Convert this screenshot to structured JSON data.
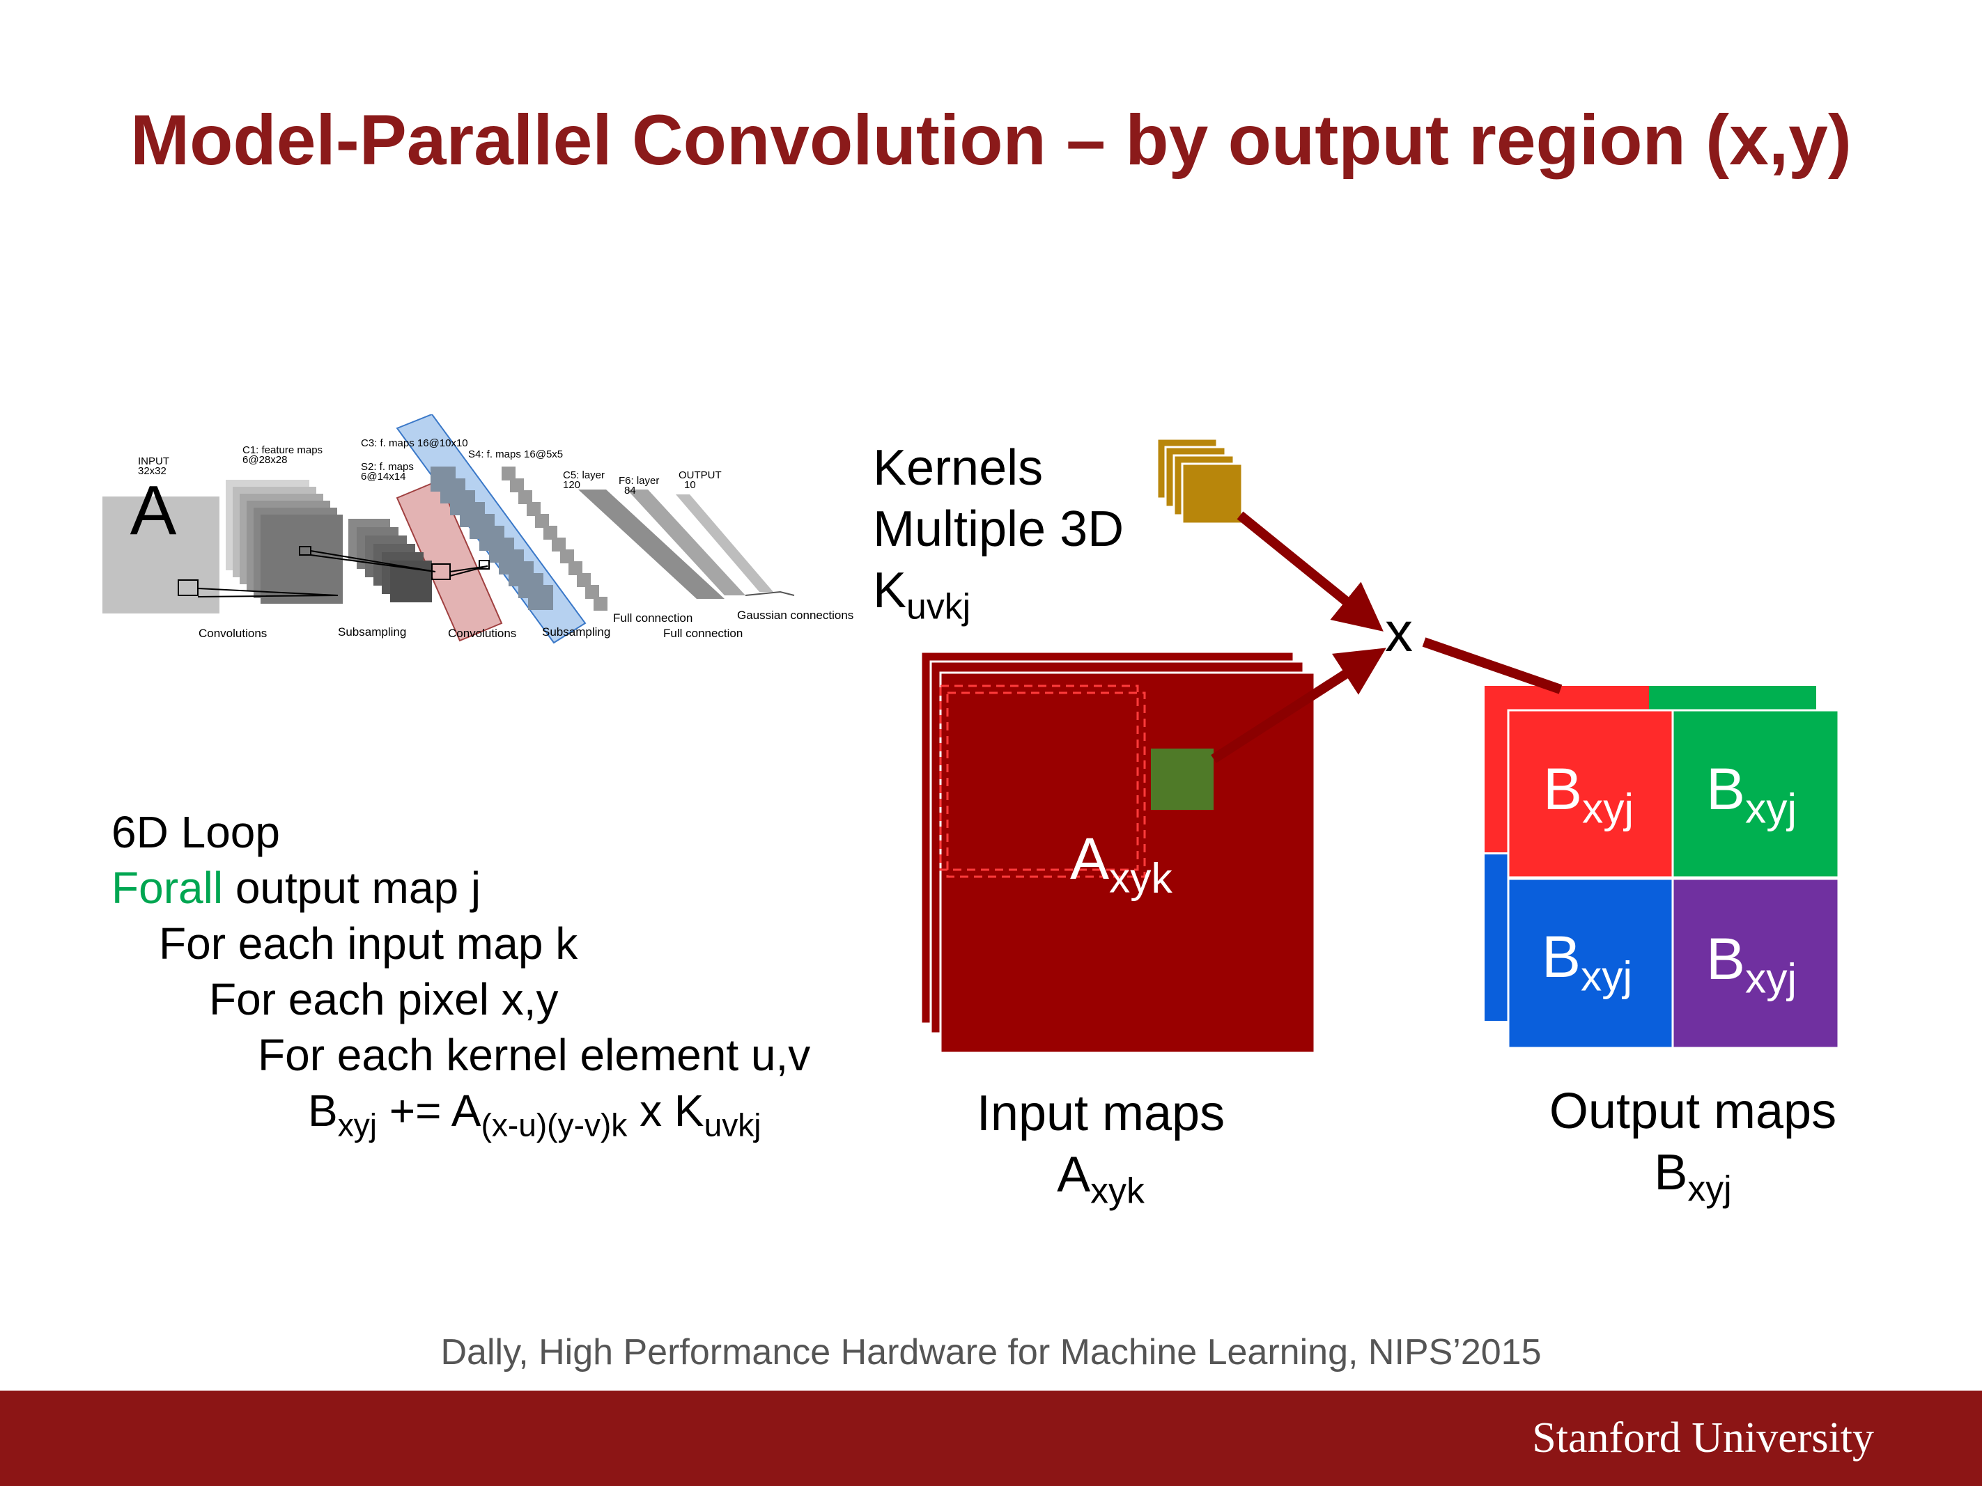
{
  "slide": {
    "title": "Model-Parallel Convolution – by output region (x,y)",
    "citation": "Dally, High Performance Hardware for Machine Learning, NIPS’2015",
    "footer_logo": "Stanford University"
  },
  "colors": {
    "title": "#8b1a1a",
    "footer_bar": "#8c1515",
    "input_map": "#990000",
    "kernel": "#b8860b",
    "arrow": "#8b0000",
    "kernel_window": "#4f7a28",
    "forall_keyword": "#00a651",
    "output_red": "#ff2a2a",
    "output_green": "#00b050",
    "output_blue": "#0a5fdc",
    "output_purple": "#7030a0"
  },
  "kernels_label": {
    "line1": "Kernels",
    "line2": "Multiple 3D",
    "symbol": "K",
    "symbol_sub": "uvkj"
  },
  "multiply_symbol": "x",
  "input_map_label": {
    "symbol": "A",
    "sub": "xyk"
  },
  "output_map_labels": [
    {
      "symbol": "B",
      "sub": "xyj"
    },
    {
      "symbol": "B",
      "sub": "xyj"
    },
    {
      "symbol": "B",
      "sub": "xyj"
    },
    {
      "symbol": "B",
      "sub": "xyj"
    }
  ],
  "input_caption": {
    "line1": "Input maps",
    "symbol": "A",
    "sub": "xyk"
  },
  "output_caption": {
    "line1": "Output maps",
    "symbol": "B",
    "sub": "xyj"
  },
  "loop": {
    "line1": "6D Loop",
    "forall_keyword": "Forall",
    "forall_rest": " output map j",
    "line3": "For each input map k",
    "line4": "For each pixel x,y",
    "line5": "For each kernel element u,v",
    "eq_b": "B",
    "eq_b_sub": "xyj",
    "eq_op": " += A",
    "eq_a_sub": "(x-u)(y-v)k",
    "eq_x": " x K",
    "eq_k_sub": "uvkj"
  },
  "lenet": {
    "input_label": "INPUT",
    "input_size": "32x32",
    "c1_label": "C1: feature maps",
    "c1_size": "6@28x28",
    "s2_label": "S2: f. maps",
    "s2_size": "6@14x14",
    "c3_label": "C3: f. maps 16@10x10",
    "s4_label": "S4: f. maps 16@5x5",
    "c5_label": "C5: layer",
    "c5_size": "120",
    "f6_label": "F6: layer",
    "f6_size": "84",
    "output_label": "OUTPUT",
    "output_size": "10",
    "convolutions_1": "Convolutions",
    "subsampling_1": "Subsampling",
    "convolutions_2": "Convolutions",
    "subsampling_2": "Subsampling",
    "full_connection_1": "Full connection",
    "full_connection_2": "Full connection",
    "gaussian": "Gaussian connections",
    "input_glyph": "A"
  }
}
